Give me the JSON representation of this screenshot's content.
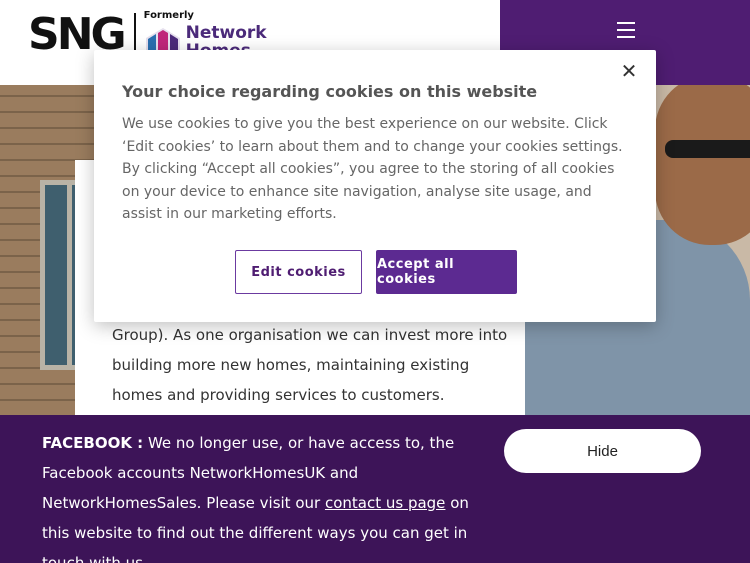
{
  "header": {
    "logo_text": "SNG",
    "formerly_label": "Formerly",
    "former_brand": "Network Homes",
    "menu_icon": "hamburger-icon"
  },
  "content": {
    "card_text": "Group). As one organisation we can invest more into building more new homes, maintaining existing homes and providing services to customers."
  },
  "cookie_dialog": {
    "title": "Your choice regarding cookies on this website",
    "body": "We use cookies to give you the best experience on our website. Click ‘Edit cookies’ to learn about them and to change your cookies settings. By clicking “Accept all cookies”, you agree to the storing of all cookies on your device to enhance site navigation, analyse site usage, and assist in our marketing efforts.",
    "close_icon": "close-icon",
    "edit_label": "Edit cookies",
    "accept_label": "Accept all cookies"
  },
  "banner": {
    "lead": "FACEBOOK :",
    "text_1": " We no longer use, or have access to, the Facebook accounts NetworkHomesUK and NetworkHomesSales. Please visit our ",
    "link_text": "contact us page",
    "text_2": " on this website to find out the different ways you can get in touch with us.",
    "hide_label": "Hide"
  },
  "colors": {
    "brand_purple": "#4f1d72",
    "banner_bg": "#3d1458",
    "accept_button": "#5c2a91"
  }
}
